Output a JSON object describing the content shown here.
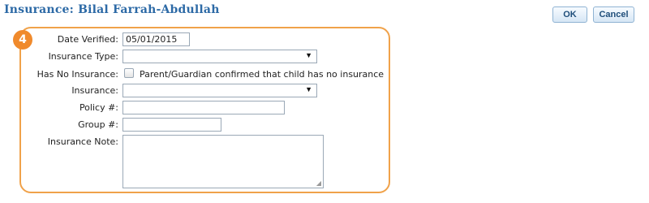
{
  "header": {
    "title": "Insurance: Bilal Farrah-Abdullah",
    "ok_label": "OK",
    "cancel_label": "Cancel"
  },
  "step_badge": "4",
  "form": {
    "date_verified": {
      "label": "Date Verified:",
      "value": "05/01/2015"
    },
    "insurance_type": {
      "label": "Insurance Type:",
      "value": ""
    },
    "has_no_insurance": {
      "label": "Has No Insurance:",
      "checked": false,
      "checkbox_text": "Parent/Guardian confirmed that child has no insurance"
    },
    "insurance": {
      "label": "Insurance:",
      "value": ""
    },
    "policy": {
      "label": "Policy #:",
      "value": ""
    },
    "group": {
      "label": "Group #:",
      "value": ""
    },
    "insurance_note": {
      "label": "Insurance Note:",
      "value": ""
    }
  },
  "colors": {
    "title": "#2d6aa6",
    "panel_border": "#f0a24a",
    "badge": "#f08a2c"
  }
}
